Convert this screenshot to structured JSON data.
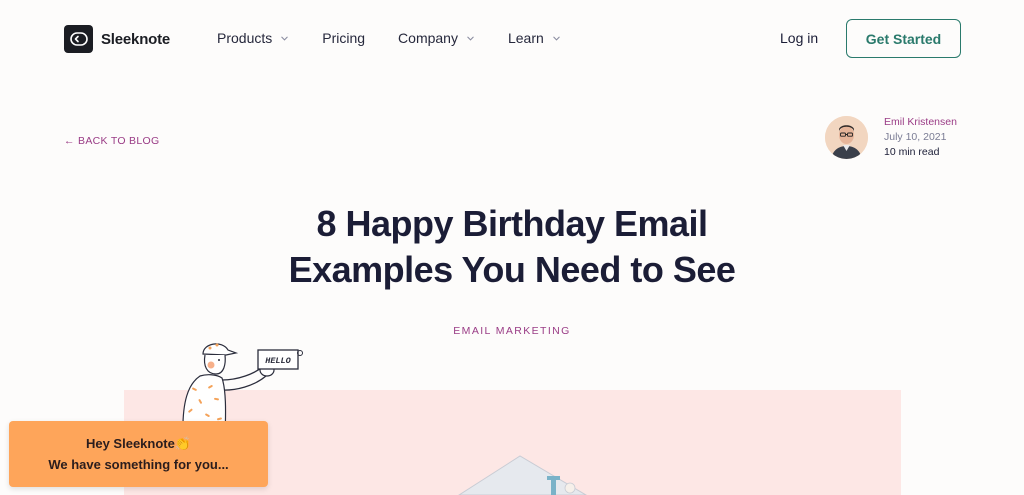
{
  "header": {
    "logo_text": "Sleeknote",
    "nav": [
      {
        "label": "Products",
        "has_dropdown": true
      },
      {
        "label": "Pricing",
        "has_dropdown": false
      },
      {
        "label": "Company",
        "has_dropdown": true
      },
      {
        "label": "Learn",
        "has_dropdown": true
      }
    ],
    "login_label": "Log in",
    "cta_label": "Get Started"
  },
  "article": {
    "back_label": "← BACK TO BLOG",
    "author_name": "Emil Kristensen",
    "date": "July 10, 2021",
    "read_time": "10 min read",
    "title_line1": "8 Happy Birthday Email",
    "title_line2": "Examples You Need to See",
    "category": "EMAIL MARKETING",
    "sign_text": "HELLO"
  },
  "popup": {
    "line1": "Hey Sleeknote👏",
    "line2": "We have something for you..."
  },
  "colors": {
    "brand_dark": "#1b1d23",
    "accent_green": "#2a7a6c",
    "accent_purple": "#9a3c86",
    "hero_bg": "#fde7e5",
    "popup_bg": "#fea55a"
  }
}
